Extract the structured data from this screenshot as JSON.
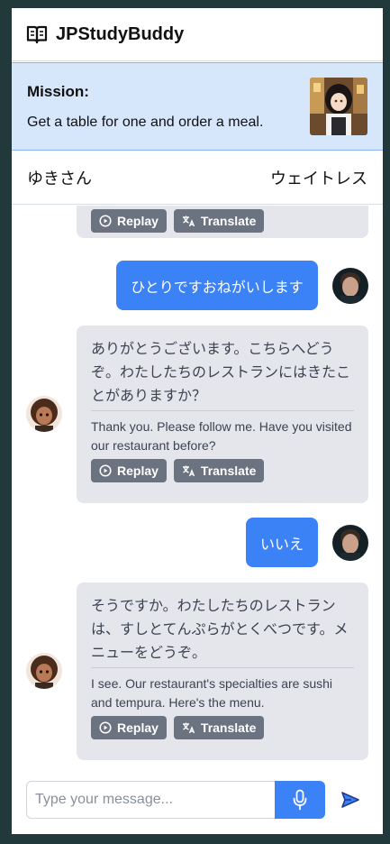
{
  "header": {
    "title": "JPStudyBuddy",
    "icon": "open-book-icon"
  },
  "mission": {
    "label": "Mission:",
    "text": "Get a table for one and order a meal.",
    "image": "waitress-character-thumbnail"
  },
  "speakers": {
    "user": "ゆきさん",
    "partner": "ウェイトレス"
  },
  "buttons": {
    "replay": "Replay",
    "translate": "Translate"
  },
  "messages": [
    {
      "role": "partner",
      "jp": "",
      "en": "",
      "partial": true
    },
    {
      "role": "user",
      "text": "ひとりですおねがいします"
    },
    {
      "role": "partner",
      "jp": "ありがとうございます。こちらへどうぞ。わたしたちのレストランにはきたことがありますか？",
      "en": "Thank you. Please follow me. Have you visited our restaurant before?"
    },
    {
      "role": "user",
      "text": "いいえ"
    },
    {
      "role": "partner",
      "jp": "そうですか。わたしたちのレストランは、すしとてんぷらがとくべつです。メニューをどうぞ。",
      "en": "I see. Our restaurant's specialties are sushi and tempura. Here's the menu."
    }
  ],
  "composer": {
    "placeholder": "Type your message..."
  },
  "colors": {
    "accent": "#3b82f6",
    "mission_bg": "#d6e6fb",
    "ai_bubble": "#e4e6ec",
    "button": "#6b7280"
  }
}
